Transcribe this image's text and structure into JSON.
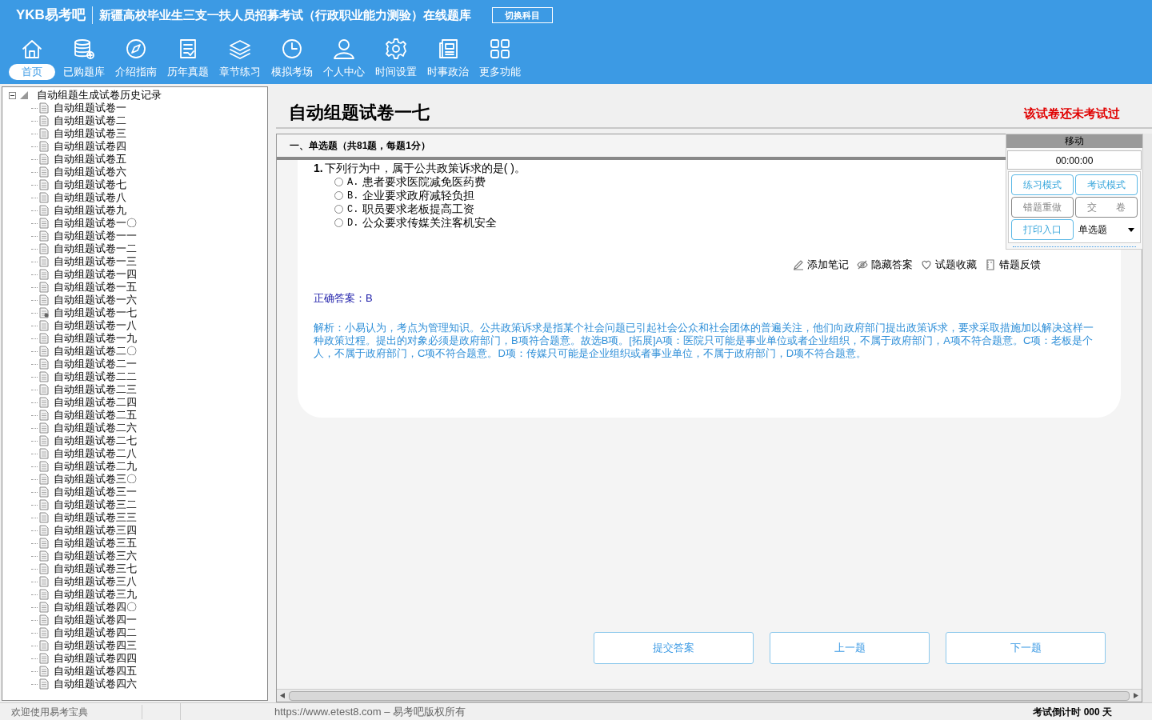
{
  "app": {
    "logo": "YKB易考吧",
    "title": "新疆高校毕业生三支一扶人员招募考试（行政职业能力测验）在线题库",
    "switch_button": "切换科目"
  },
  "nav": [
    {
      "label": "首页",
      "selected": true
    },
    {
      "label": "已购题库",
      "selected": false
    },
    {
      "label": "介绍指南",
      "selected": false
    },
    {
      "label": "历年真题",
      "selected": false
    },
    {
      "label": "章节练习",
      "selected": false
    },
    {
      "label": "模拟考场",
      "selected": false
    },
    {
      "label": "个人中心",
      "selected": false
    },
    {
      "label": "时间设置",
      "selected": false
    },
    {
      "label": "时事政治",
      "selected": false
    },
    {
      "label": "更多功能",
      "selected": false
    }
  ],
  "tree": {
    "label": "自动组题生成试卷历史记录",
    "expanded": true,
    "children": [
      {
        "label": "自动组题试卷一",
        "selected": false
      },
      {
        "label": "自动组题试卷二",
        "selected": false
      },
      {
        "label": "自动组题试卷三",
        "selected": false
      },
      {
        "label": "自动组题试卷四",
        "selected": false
      },
      {
        "label": "自动组题试卷五",
        "selected": false
      },
      {
        "label": "自动组题试卷六",
        "selected": false
      },
      {
        "label": "自动组题试卷七",
        "selected": false
      },
      {
        "label": "自动组题试卷八",
        "selected": false
      },
      {
        "label": "自动组题试卷九",
        "selected": false
      },
      {
        "label": "自动组题试卷一〇",
        "selected": false
      },
      {
        "label": "自动组题试卷一一",
        "selected": false
      },
      {
        "label": "自动组题试卷一二",
        "selected": false
      },
      {
        "label": "自动组题试卷一三",
        "selected": false
      },
      {
        "label": "自动组题试卷一四",
        "selected": false
      },
      {
        "label": "自动组题试卷一五",
        "selected": false
      },
      {
        "label": "自动组题试卷一六",
        "selected": false
      },
      {
        "label": "自动组题试卷一七",
        "selected": true
      },
      {
        "label": "自动组题试卷一八",
        "selected": false
      },
      {
        "label": "自动组题试卷一九",
        "selected": false
      },
      {
        "label": "自动组题试卷二〇",
        "selected": false
      },
      {
        "label": "自动组题试卷二一",
        "selected": false
      },
      {
        "label": "自动组题试卷二二",
        "selected": false
      },
      {
        "label": "自动组题试卷二三",
        "selected": false
      },
      {
        "label": "自动组题试卷二四",
        "selected": false
      },
      {
        "label": "自动组题试卷二五",
        "selected": false
      },
      {
        "label": "自动组题试卷二六",
        "selected": false
      },
      {
        "label": "自动组题试卷二七",
        "selected": false
      },
      {
        "label": "自动组题试卷二八",
        "selected": false
      },
      {
        "label": "自动组题试卷二九",
        "selected": false
      },
      {
        "label": "自动组题试卷三〇",
        "selected": false
      },
      {
        "label": "自动组题试卷三一",
        "selected": false
      },
      {
        "label": "自动组题试卷三二",
        "selected": false
      },
      {
        "label": "自动组题试卷三三",
        "selected": false
      },
      {
        "label": "自动组题试卷三四",
        "selected": false
      },
      {
        "label": "自动组题试卷三五",
        "selected": false
      },
      {
        "label": "自动组题试卷三六",
        "selected": false
      },
      {
        "label": "自动组题试卷三七",
        "selected": false
      },
      {
        "label": "自动组题试卷三八",
        "selected": false
      },
      {
        "label": "自动组题试卷三九",
        "selected": false
      },
      {
        "label": "自动组题试卷四〇",
        "selected": false
      },
      {
        "label": "自动组题试卷四一",
        "selected": false
      },
      {
        "label": "自动组题试卷四二",
        "selected": false
      },
      {
        "label": "自动组题试卷四三",
        "selected": false
      },
      {
        "label": "自动组题试卷四四",
        "selected": false
      },
      {
        "label": "自动组题试卷四五",
        "selected": false
      },
      {
        "label": "自动组题试卷四六",
        "selected": false
      }
    ]
  },
  "paper": {
    "title": "自动组题试卷一七",
    "status": "该试卷还未考试过"
  },
  "section": "一、单选题（共81题，每题1分）",
  "question": {
    "number": "1.",
    "text": "下列行为中，属于公共政策诉求的是( )。",
    "options": [
      {
        "letter": "A.",
        "text": "患者要求医院减免医药费",
        "selected": false
      },
      {
        "letter": "B.",
        "text": "企业要求政府减轻负担",
        "selected": false
      },
      {
        "letter": "C.",
        "text": "职员要求老板提高工资",
        "selected": false
      },
      {
        "letter": "D.",
        "text": "公众要求传媒关注客机安全",
        "selected": false
      }
    ]
  },
  "actions": [
    "添加笔记",
    "隐藏答案",
    "试题收藏",
    "错题反馈"
  ],
  "answer": "正确答案：B",
  "explanation": "解析：小易认为，考点为管理知识。公共政策诉求是指某个社会问题已引起社会公众和社会团体的普遍关注，他们向政府部门提出政策诉求，要求采取措施加以解决这样一种政策过程。提出的对象必须是政府部门，B项符合题意。故选B项。[拓展]A项：医院只可能是事业单位或者企业组织，不属于政府部门，A项不符合题意。C项：老板是个人，不属于政府部门，C项不符合题意。D项：传媒只可能是企业组织或者事业单位，不属于政府部门，D项不符合题意。",
  "float_panel": {
    "handle": "移动",
    "timer": "00:00:00",
    "buttons": [
      {
        "label": "练习模式",
        "disabled": false
      },
      {
        "label": "考试模式",
        "disabled": false
      },
      {
        "label": "错题重做",
        "disabled": true
      },
      {
        "label": "交　　卷",
        "disabled": true
      },
      {
        "label": "打印入口",
        "disabled": false
      }
    ],
    "type_select": "单选题"
  },
  "bottom_buttons": [
    "提交答案",
    "上一题",
    "下一题"
  ],
  "status_bar": {
    "welcome": "欢迎使用易考宝典",
    "copyright": "https://www.etest8.com – 易考吧版权所有",
    "countdown": "考试倒计时 000 天"
  }
}
